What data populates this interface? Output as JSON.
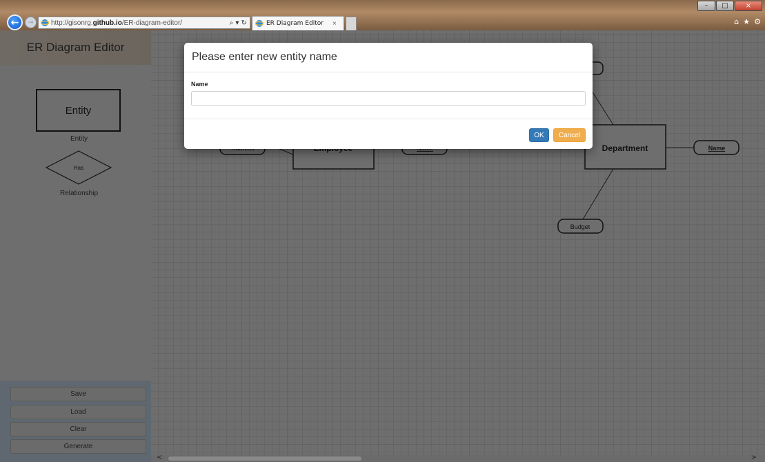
{
  "browser": {
    "url_prefix": "http://gisonrg.",
    "url_domain": "github.io",
    "url_suffix": "/ER-diagram-editor/",
    "address_tools": "⌕ ▾ ↻",
    "tab_title": "ER Diagram Editor",
    "tab_close": "×",
    "back_glyph": "←",
    "forward_glyph": "→",
    "window_controls": {
      "minimize": "–",
      "maximize": "□",
      "close": "×"
    },
    "right_tools": [
      "⌂",
      "★",
      "⚙"
    ]
  },
  "sidebar": {
    "title": "ER Diagram Editor",
    "palette": {
      "entity_label": "Entity",
      "entity_caption": "Entity",
      "relationship_label": "Has",
      "relationship_caption": "Relationship"
    },
    "buttons": {
      "save": "Save",
      "load": "Load",
      "clear": "Clear",
      "generate": "Generate"
    }
  },
  "canvas": {
    "entities": [
      {
        "name": "Employee"
      },
      {
        "name": "Department"
      }
    ],
    "attributes": [
      {
        "name": "Address",
        "key": false
      },
      {
        "name": "Name",
        "key": true
      },
      {
        "name": "Name",
        "key": true
      },
      {
        "name": "Budget",
        "key": false
      }
    ]
  },
  "scrollbar": {
    "left_arrow": "<",
    "right_arrow": ">"
  },
  "modal": {
    "title": "Please enter new entity name",
    "field_label": "Name",
    "field_value": "",
    "field_placeholder": "",
    "ok_label": "OK",
    "cancel_label": "Cancel"
  },
  "colors": {
    "ok": "#337ab7",
    "cancel": "#f0ad4e",
    "overlay": "#6e6e6e"
  }
}
